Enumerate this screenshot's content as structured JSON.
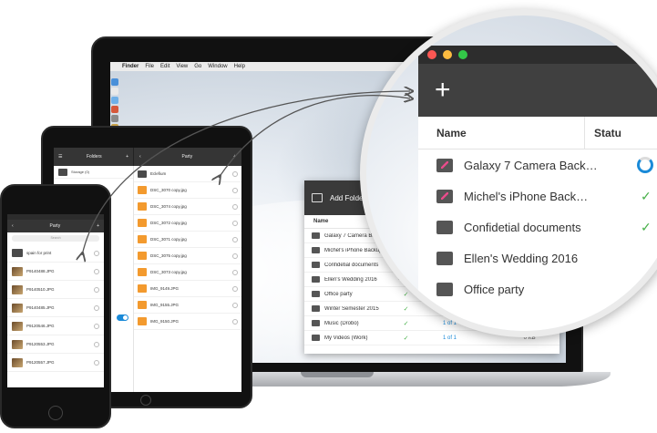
{
  "mac_menubar": {
    "items": [
      "Finder",
      "File",
      "Edit",
      "View",
      "Go",
      "Window",
      "Help"
    ]
  },
  "mac_app": {
    "title": "Add Folder",
    "column_name": "Name",
    "rows": [
      {
        "name": "Galaxy 7 Camera Backup",
        "status": "",
        "progress": "",
        "size": ""
      },
      {
        "name": "Michel's iPhone Backup",
        "status": "",
        "progress": "",
        "size": ""
      },
      {
        "name": "Confidetial documents",
        "status": "✓",
        "progress": "",
        "size": ""
      },
      {
        "name": "Ellen's Wedding 2016",
        "status": "45%",
        "progress": "",
        "size": ""
      },
      {
        "name": "Office party",
        "status": "✓",
        "progress": "3 of 3",
        "size": "3.95 GB"
      },
      {
        "name": "Winter Semester 2015",
        "status": "✓",
        "progress": "1 of 12",
        "size": "0 KB"
      },
      {
        "name": "Music (Drobo)",
        "status": "✓",
        "progress": "1 of 1",
        "size": "0 KB"
      },
      {
        "name": "My Videos (Work)",
        "status": "✓",
        "progress": "1 of 1",
        "size": "0 KB"
      }
    ]
  },
  "magnifier": {
    "add_label": "+",
    "column_name": "Name",
    "column_status": "Statu",
    "rows": [
      {
        "name": "Galaxy 7 Camera Back…",
        "state": "syncing"
      },
      {
        "name": "Michel's iPhone Back…",
        "state": "done"
      },
      {
        "name": "Confidetial documents",
        "state": "done"
      },
      {
        "name": "Ellen's Wedding 2016",
        "state": ""
      },
      {
        "name": "Office party",
        "state": ""
      }
    ],
    "colors": {
      "close": "#fc5753",
      "minimize": "#fdbc40",
      "zoom": "#33c748",
      "accent": "#1a8ad8",
      "check": "#48b04a"
    }
  },
  "tablet": {
    "left_title": "Folders",
    "left_rows": [
      "Storage (0)"
    ],
    "right_title": "Party",
    "rows": [
      {
        "name": "Eclefium",
        "sub": "",
        "type": "folder"
      },
      {
        "name": "DSC_3070 copy.jpg",
        "sub": "",
        "type": "image"
      },
      {
        "name": "DSC_3074 copy.jpg",
        "sub": "",
        "type": "image"
      },
      {
        "name": "DSC_3072 copy.jpg",
        "sub": "",
        "type": "image"
      },
      {
        "name": "DSC_3071 copy.jpg",
        "sub": "",
        "type": "image"
      },
      {
        "name": "DSC_3075 copy.jpg",
        "sub": "",
        "type": "image"
      },
      {
        "name": "DSC_3073 copy.jpg",
        "sub": "",
        "type": "image"
      },
      {
        "name": "IMG_9149.JPG",
        "sub": "",
        "type": "image"
      },
      {
        "name": "IMG_9155.JPG",
        "sub": "",
        "type": "image"
      },
      {
        "name": "IMG_9150.JPG",
        "sub": "",
        "type": "image"
      }
    ]
  },
  "phone": {
    "title": "Party",
    "back": "‹",
    "add": "+",
    "search_placeholder": "Search",
    "rows": [
      {
        "name": "spain for print",
        "sub": "",
        "type": "folder"
      },
      {
        "name": "P9140488.JPG",
        "sub": "",
        "type": "photo"
      },
      {
        "name": "P9140510.JPG",
        "sub": "",
        "type": "photo"
      },
      {
        "name": "P9140485.JPG",
        "sub": "",
        "type": "photo"
      },
      {
        "name": "P9120546.JPG",
        "sub": "",
        "type": "photo"
      },
      {
        "name": "P9120553.JPG",
        "sub": "",
        "type": "photo"
      },
      {
        "name": "P9120557.JPG",
        "sub": "",
        "type": "photo"
      }
    ]
  }
}
